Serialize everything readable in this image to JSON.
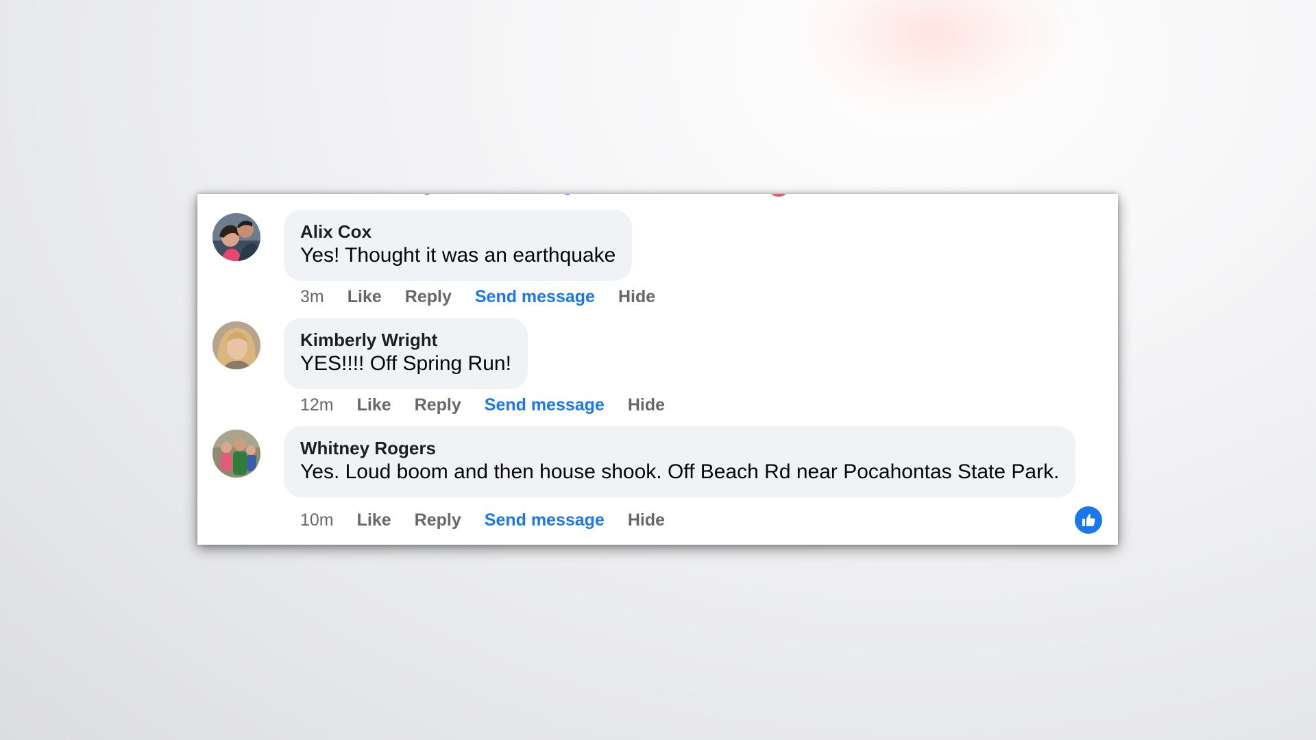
{
  "comments": [
    {
      "author": "Alix Cox",
      "text": "Yes! Thought it was an earthquake",
      "time": "3m",
      "actions": {
        "like": "Like",
        "reply": "Reply",
        "send": "Send message",
        "hide": "Hide"
      }
    },
    {
      "author": "Kimberly Wright",
      "text": "YES!!!! Off Spring Run!",
      "time": "12m",
      "actions": {
        "like": "Like",
        "reply": "Reply",
        "send": "Send message",
        "hide": "Hide"
      }
    },
    {
      "author": "Whitney Rogers",
      "text": "Yes. Loud boom and then house shook. Off Beach Rd near Pocahontas State Park.",
      "time": "10m",
      "actions": {
        "like": "Like",
        "reply": "Reply",
        "send": "Send message",
        "hide": "Hide"
      }
    }
  ],
  "icons": {
    "reaction": "thumbs-up-icon"
  },
  "colors": {
    "link_blue": "#1877f2",
    "meta_gray": "#65676b",
    "bubble_bg": "#f0f2f5"
  }
}
